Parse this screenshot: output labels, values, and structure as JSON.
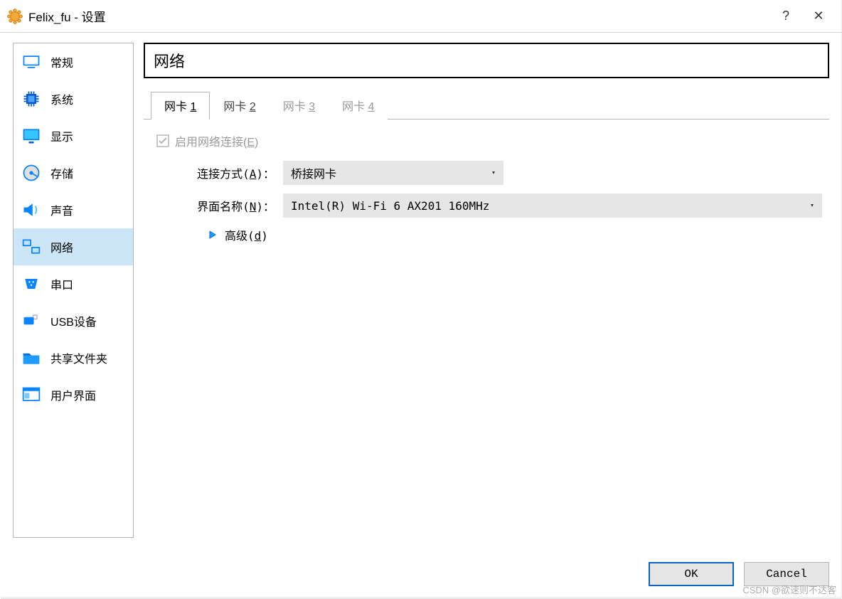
{
  "window": {
    "title": "Felix_fu - 设置",
    "help_label": "?",
    "close_label": "✕"
  },
  "sidebar": {
    "items": [
      {
        "id": "general",
        "label": "常规"
      },
      {
        "id": "system",
        "label": "系统"
      },
      {
        "id": "display",
        "label": "显示"
      },
      {
        "id": "storage",
        "label": "存储"
      },
      {
        "id": "audio",
        "label": "声音"
      },
      {
        "id": "network",
        "label": "网络"
      },
      {
        "id": "serial",
        "label": "串口"
      },
      {
        "id": "usb",
        "label": "USB设备"
      },
      {
        "id": "shared",
        "label": "共享文件夹"
      },
      {
        "id": "ui",
        "label": "用户界面"
      }
    ],
    "selected_id": "network"
  },
  "panel": {
    "title": "网络",
    "tabs": [
      {
        "prefix": "网卡 ",
        "accel": "1",
        "active": true,
        "disabled": false
      },
      {
        "prefix": "网卡 ",
        "accel": "2",
        "active": false,
        "disabled": false
      },
      {
        "prefix": "网卡 ",
        "accel": "3",
        "active": false,
        "disabled": true
      },
      {
        "prefix": "网卡 ",
        "accel": "4",
        "active": false,
        "disabled": true
      }
    ],
    "enable_network": {
      "label_prefix": "启用网络连接(",
      "accel": "E",
      "label_suffix": ")",
      "checked": true,
      "disabled": true
    },
    "fields": {
      "attached": {
        "label_prefix": "连接方式(",
        "accel": "A",
        "label_suffix": ")：",
        "value": "桥接网卡"
      },
      "name": {
        "label_prefix": "界面名称(",
        "accel": "N",
        "label_suffix": ")：",
        "value": "Intel(R) Wi-Fi 6 AX201 160MHz"
      }
    },
    "advanced": {
      "label_prefix": "高级(",
      "accel": "d",
      "label_suffix": ")"
    }
  },
  "footer": {
    "ok": "OK",
    "cancel": "Cancel"
  },
  "watermark": "CSDN @欲速则不达客"
}
